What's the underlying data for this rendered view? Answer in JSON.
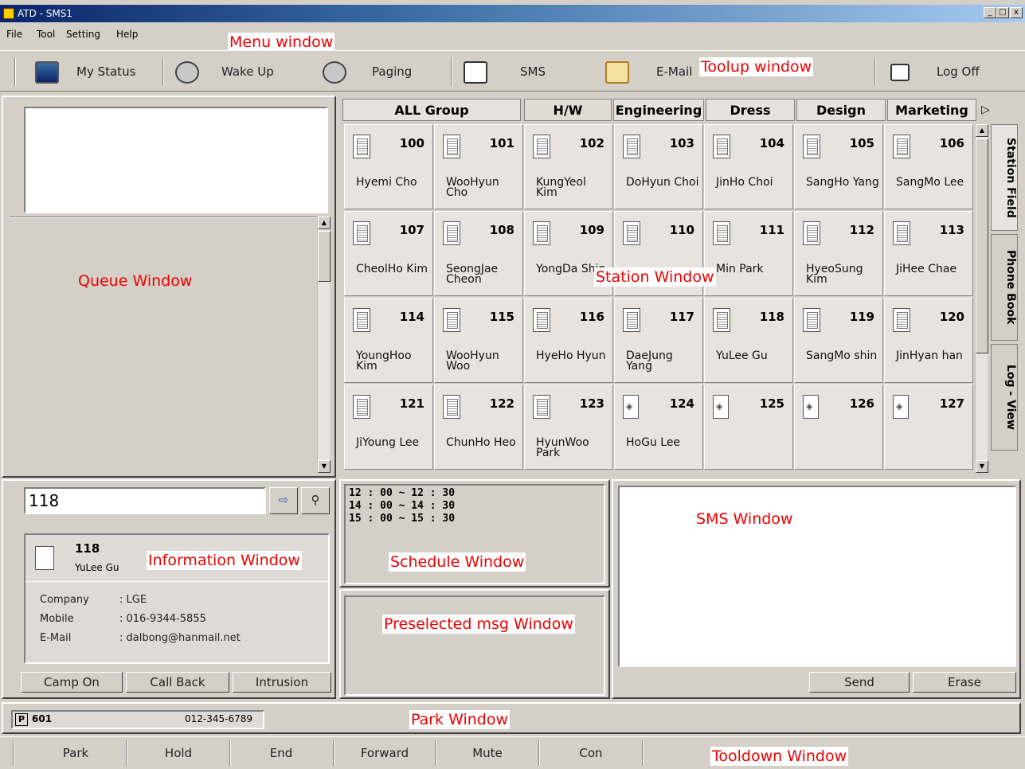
{
  "window": {
    "title": "ATD - SMS1",
    "min": "_",
    "max": "□",
    "close": "x"
  },
  "menu": {
    "items": [
      "File",
      "Tool",
      "Setting",
      "Help"
    ]
  },
  "toolbar": {
    "my_status": "My Status",
    "wake_up": "Wake Up",
    "paging": "Paging",
    "sms": "SMS",
    "email": "E-Mail",
    "log_off": "Log Off"
  },
  "annotations": {
    "menu": "Menu window",
    "toolup": "Toolup window",
    "queue": "Queue Window",
    "station": "Station Window",
    "information": "Information Window",
    "schedule": "Schedule Window",
    "preselected": "Preselected msg Window",
    "sms": "SMS Window",
    "park": "Park Window",
    "tooldown": "Tooldown Window"
  },
  "group_tabs": [
    "ALL Group",
    "H/W",
    "Engineering",
    "Dress",
    "Design",
    "Marketing"
  ],
  "side_tabs": [
    "Station Field",
    "Phone Book",
    "Log - View"
  ],
  "stations": [
    {
      "num": "100",
      "name": "Hyemi Cho"
    },
    {
      "num": "101",
      "name": "WooHyun Cho"
    },
    {
      "num": "102",
      "name": "KungYeol Kim"
    },
    {
      "num": "103",
      "name": "DoHyun Choi"
    },
    {
      "num": "104",
      "name": "JinHo Choi"
    },
    {
      "num": "105",
      "name": "SangHo Yang"
    },
    {
      "num": "106",
      "name": "SangMo Lee"
    },
    {
      "num": "107",
      "name": "CheolHo Kim"
    },
    {
      "num": "108",
      "name": "SeongJae Cheon"
    },
    {
      "num": "109",
      "name": "YongDa Shin"
    },
    {
      "num": "110",
      "name": ""
    },
    {
      "num": "111",
      "name": "Min Park"
    },
    {
      "num": "112",
      "name": "HyeoSung Kim"
    },
    {
      "num": "113",
      "name": "JiHee Chae"
    },
    {
      "num": "114",
      "name": "YoungHoo Kim"
    },
    {
      "num": "115",
      "name": "WooHyun Woo"
    },
    {
      "num": "116",
      "name": "HyeHo Hyun"
    },
    {
      "num": "117",
      "name": "DaeJung Yang"
    },
    {
      "num": "118",
      "name": "YuLee Gu"
    },
    {
      "num": "119",
      "name": "SangMo shin"
    },
    {
      "num": "120",
      "name": "JinHyan han"
    },
    {
      "num": "121",
      "name": "JiYoung Lee"
    },
    {
      "num": "122",
      "name": "ChunHo Heo"
    },
    {
      "num": "123",
      "name": "HyunWoo Park"
    },
    {
      "num": "124",
      "name": "HoGu Lee"
    },
    {
      "num": "125",
      "name": ""
    },
    {
      "num": "126",
      "name": ""
    },
    {
      "num": "127",
      "name": ""
    }
  ],
  "search": {
    "value": "118"
  },
  "info": {
    "number": "118",
    "name": "YuLee Gu",
    "company_label": "Company",
    "company": ": LGE",
    "mobile_label": "Mobile",
    "mobile": ": 016-9344-5855",
    "email_label": "E-Mail",
    "email": ": dalbong@hanmail.net"
  },
  "call_buttons": {
    "camp_on": "Camp On",
    "call_back": "Call Back",
    "intrusion": "Intrusion"
  },
  "schedule": [
    "12 : 00 ~ 12 : 30",
    "14 : 00 ~ 14 : 30",
    "15 : 00 ~ 15 : 30"
  ],
  "sms_buttons": {
    "send": "Send",
    "erase": "Erase"
  },
  "park": {
    "badge": "P",
    "slot": "601",
    "number": "012-345-6789"
  },
  "bottom_tools": [
    "Park",
    "Hold",
    "End",
    "Forward",
    "Mute",
    "Con"
  ]
}
